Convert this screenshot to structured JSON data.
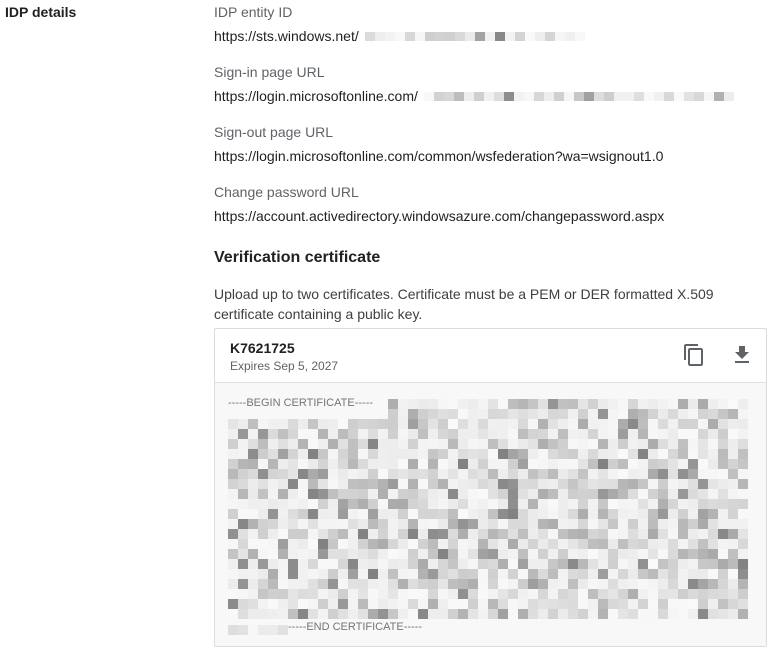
{
  "section": {
    "title": "IDP details"
  },
  "fields": [
    {
      "label": "IDP entity ID",
      "value": "https://sts.windows.net/"
    },
    {
      "label": "Sign-in page URL",
      "value": "https://login.microsoftonline.com/"
    },
    {
      "label": "Sign-out page URL",
      "value": "https://login.microsoftonline.com/common/wsfederation?wa=wsignout1.0"
    },
    {
      "label": "Change password URL",
      "value": "https://account.activedirectory.windowsazure.com/changepassword.aspx"
    }
  ],
  "verification": {
    "title": "Verification certificate",
    "description": "Upload up to two certificates. Certificate must be a PEM or DER formatted X.509 certificate containing a public key."
  },
  "certificate": {
    "name": "K7621725",
    "expires": "Expires Sep 5, 2027",
    "begin_marker": "-----BEGIN CERTIFICATE-----",
    "end_marker": "-----END CERTIFICATE-----",
    "copy_icon": "copy-icon",
    "download_icon": "download-icon"
  }
}
